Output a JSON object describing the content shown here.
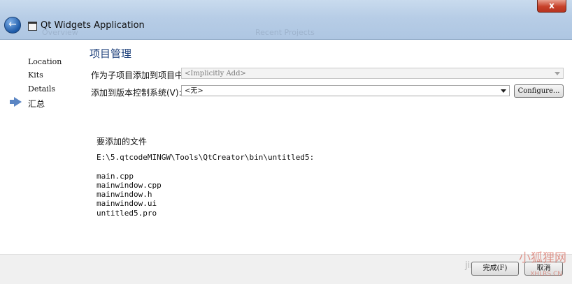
{
  "window": {
    "title": "Qt Widgets Application",
    "close_label": "x",
    "ghost_left": "Overview",
    "ghost_center": "Recent Projects"
  },
  "sidebar": {
    "items": [
      {
        "label": "Location"
      },
      {
        "label": "Kits"
      },
      {
        "label": "Details"
      },
      {
        "label": "汇总",
        "current": true
      }
    ]
  },
  "main": {
    "page_title": "项目管理",
    "subproject_label": "作为子项目添加到项目中:",
    "subproject_value": "<Implicitly Add>",
    "vcs_label": "添加到版本控制系统(V):",
    "vcs_value": "<无>",
    "configure_label": "Configure...",
    "files_heading": "要添加的文件",
    "path": "E:\\5.qtcodeMINGW\\Tools\\QtCreator\\bin\\untitled5:",
    "files": [
      "main.cpp",
      "mainwindow.cpp",
      "mainwindow.h",
      "mainwindow.ui",
      "untitled5.pro"
    ]
  },
  "footer": {
    "finish_label": "完成(F)",
    "cancel_label": "取消"
  },
  "watermark": {
    "brand": "小狐狸网",
    "domain": "XHLRS.CN",
    "partial": "jing"
  },
  "colors": {
    "titlebar": "#b7cde6",
    "accent": "#5b86c4",
    "close": "#c7412a"
  }
}
